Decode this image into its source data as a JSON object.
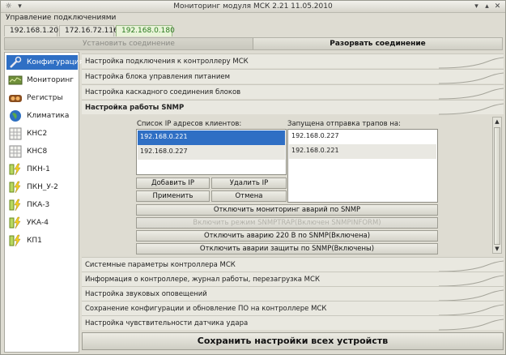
{
  "window": {
    "title": "Мониторинг модуля МСК 2.21 11.05.2010",
    "controls": [
      "☼",
      "▾",
      "▴",
      "✕"
    ]
  },
  "menu": {
    "label": "Управление подключениями"
  },
  "tabs": [
    {
      "label": "192.168.1.20"
    },
    {
      "label": "172.16.72.116"
    },
    {
      "label": "192.168.0.180"
    }
  ],
  "connection": {
    "connect_label": "Установить соединение",
    "disconnect_label": "Разорвать соединение"
  },
  "sidebar": {
    "items": [
      {
        "label": "Конфигурация",
        "icon": "wrench-icon"
      },
      {
        "label": "Мониторинг",
        "icon": "monitor-chart-icon"
      },
      {
        "label": "Регистры",
        "icon": "registers-icon"
      },
      {
        "label": "Климатика",
        "icon": "globe-icon"
      },
      {
        "label": "КНС2",
        "icon": "grid-device-icon"
      },
      {
        "label": "КНС8",
        "icon": "grid-device-icon"
      },
      {
        "label": "ПКН-1",
        "icon": "lightning-icon"
      },
      {
        "label": "ПКН_У-2",
        "icon": "lightning-icon"
      },
      {
        "label": "ПКА-3",
        "icon": "lightning-icon"
      },
      {
        "label": "УКА-4",
        "icon": "lightning-icon"
      },
      {
        "label": "КП1",
        "icon": "lightning-icon"
      }
    ]
  },
  "sections_top": [
    {
      "label": "Настройка подключения к контроллеру МСК"
    },
    {
      "label": "Настройка блока управления питанием"
    },
    {
      "label": "Настройка каскадного соединения блоков"
    },
    {
      "label": "Настройка работы SNMP"
    }
  ],
  "snmp": {
    "clients_label": "Список IP адресов клиентов:",
    "clients": [
      "192.168.0.221",
      "192.168.0.227"
    ],
    "traps_label": "Запущена отправка трапов на:",
    "traps": [
      "192.168.0.227",
      "192.168.0.221"
    ],
    "add_ip": "Добавить IP",
    "delete_ip": "Удалить IP",
    "apply": "Применить",
    "cancel": "Отмена",
    "toggle_alarm_monitoring": "Отключить мониторинг аварий по SNMP",
    "enable_trap_mode": "Включить режим SNMPTRAP(Включен SNMPINFORM)",
    "disable_220v": "Отключить аварию 220 В по SNMP(Включена)",
    "disable_protection": "Отключить аварии защиты по SNMP(Включены)"
  },
  "sections_bottom": [
    {
      "label": "Системные параметры контроллера МСК"
    },
    {
      "label": "Информация о контроллере, журнал работы, перезагрузка МСК"
    },
    {
      "label": "Настройка звуковых оповещений"
    },
    {
      "label": "Сохранение конфигурации и обновление ПО на контроллере МСК"
    },
    {
      "label": "Настройка чувствительности датчика удара"
    }
  ],
  "save_all": "Сохранить настройки всех устройств",
  "colors": {
    "selection": "#2f6fc4",
    "active_tab_text": "#2a7a1e",
    "window_bg": "#dedcd2"
  }
}
